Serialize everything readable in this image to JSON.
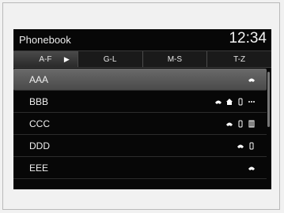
{
  "window": {
    "title": "Phonebook",
    "time": "12:34"
  },
  "tabs": [
    {
      "label": "A-F",
      "active": true
    },
    {
      "label": "G-L",
      "active": false
    },
    {
      "label": "M-S",
      "active": false
    },
    {
      "label": "T-Z",
      "active": false
    }
  ],
  "contacts": [
    {
      "name": "AAA",
      "icons": [
        "car-phone-icon"
      ]
    },
    {
      "name": "BBB",
      "icons": [
        "car-phone-icon",
        "home-icon",
        "mobile-icon",
        "more-icon"
      ]
    },
    {
      "name": "CCC",
      "icons": [
        "car-phone-icon",
        "mobile-icon",
        "work-icon"
      ]
    },
    {
      "name": "DDD",
      "icons": [
        "car-phone-icon",
        "mobile-icon"
      ]
    },
    {
      "name": "EEE",
      "icons": [
        "car-phone-icon"
      ]
    }
  ]
}
